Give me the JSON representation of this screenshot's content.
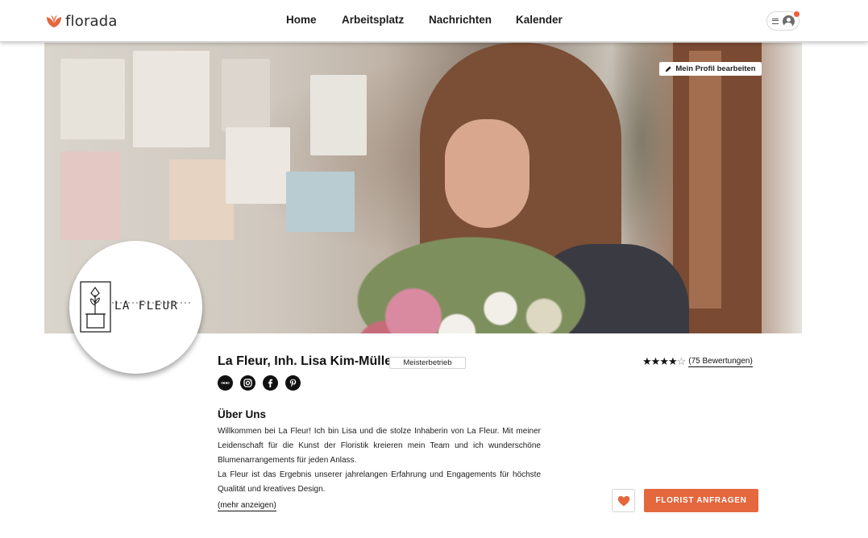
{
  "app": {
    "name": "florada",
    "brand_color": "#e4673e"
  },
  "nav": {
    "items": [
      {
        "label": "Home"
      },
      {
        "label": "Arbeitsplatz"
      },
      {
        "label": "Nachrichten"
      },
      {
        "label": "Kalender"
      }
    ]
  },
  "header": {
    "menu_icon": "hamburger-icon",
    "avatar_icon": "user-avatar-icon",
    "has_notification": true
  },
  "hero": {
    "edit_button_label": "Mein Profil bearbeiten",
    "edit_icon": "pencil-icon"
  },
  "profile": {
    "logo_text": "LA FLEUR",
    "name": "La Fleur, Inh. Lisa Kim-Müller",
    "badge": "Meisterbetrieb",
    "socials": [
      {
        "icon": "website-icon"
      },
      {
        "icon": "instagram-icon"
      },
      {
        "icon": "facebook-icon"
      },
      {
        "icon": "pinterest-icon"
      }
    ]
  },
  "rating": {
    "stars": 4,
    "max": 5,
    "reviews_label": "(75 Bewertungen)"
  },
  "about": {
    "title": "Über Uns",
    "paragraph1": "Willkommen bei La Fleur! Ich bin Lisa und die stolze Inhaberin von La Fleur. Mit meiner Leidenschaft für die Kunst der Floristik kreieren mein Team und ich wunderschöne Blumenarrangements für jeden Anlass.",
    "paragraph2": "La Fleur ist das Ergebnis unserer jahrelangen Erfahrung und Engagements für höchste Qualität und kreatives Design.",
    "more_label": "(mehr anzeigen)"
  },
  "actions": {
    "favorite_icon": "heart-icon",
    "cta_label": "FLORIST ANFRAGEN"
  }
}
